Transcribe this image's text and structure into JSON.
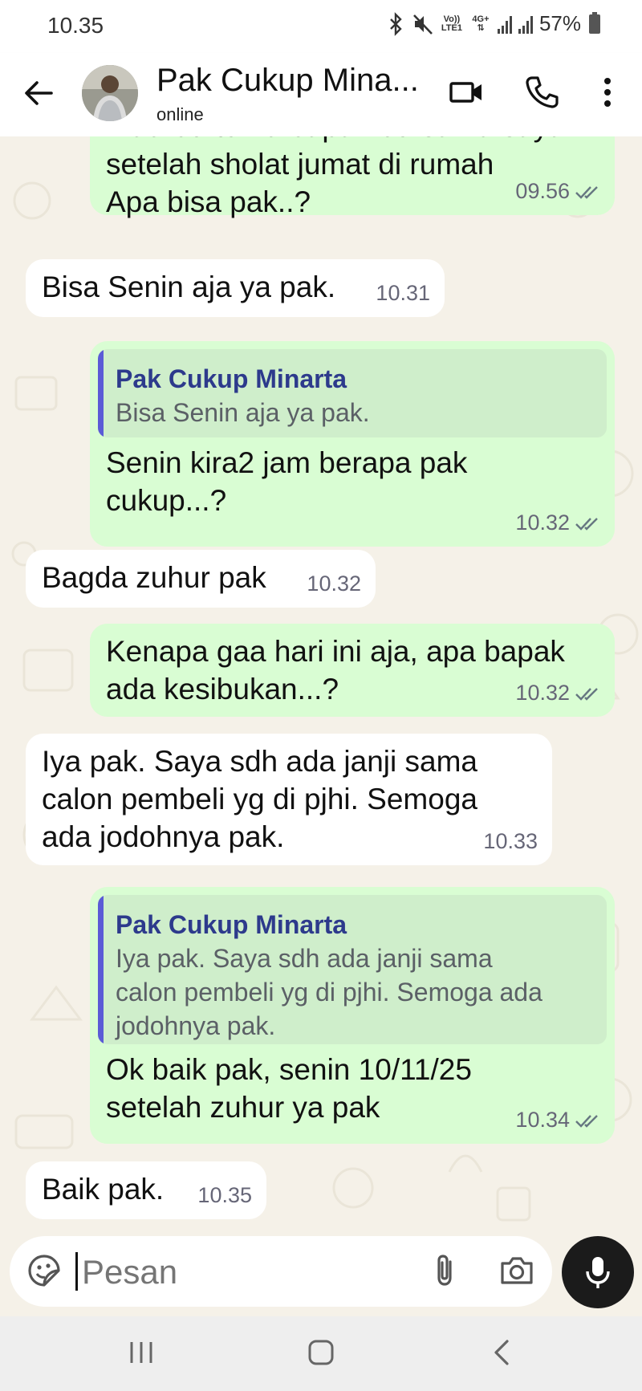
{
  "status_bar": {
    "time": "10.35",
    "network_label": "Vo)) LTE1",
    "network_type": "4G+",
    "battery": "57%"
  },
  "header": {
    "contact_name": "Pak Cukup Mina...",
    "status": "online"
  },
  "messages": [
    {
      "dir": "out",
      "text": [
        "Mau bertemu bapak bersama saya",
        "setelah sholat jumat di rumah",
        "Apa bisa pak..?"
      ],
      "time": "09.56"
    },
    {
      "dir": "in",
      "text": [
        "Bisa Senin aja ya pak."
      ],
      "time": "10.31"
    },
    {
      "dir": "out",
      "quote": {
        "name": "Pak Cukup Minarta",
        "text": [
          "Bisa Senin aja ya pak."
        ]
      },
      "text": [
        "Senin kira2 jam berapa pak",
        "cukup...?"
      ],
      "time": "10.32"
    },
    {
      "dir": "in",
      "text": [
        "Bagda zuhur pak"
      ],
      "time": "10.32"
    },
    {
      "dir": "out",
      "text": [
        "Kenapa gaa hari ini aja, apa bapak",
        "ada kesibukan...?"
      ],
      "time": "10.32"
    },
    {
      "dir": "in",
      "text": [
        "Iya pak. Saya sdh ada janji sama",
        "calon pembeli yg di pjhi. Semoga",
        "ada jodohnya pak."
      ],
      "time": "10.33"
    },
    {
      "dir": "out",
      "quote": {
        "name": "Pak Cukup Minarta",
        "text": [
          "Iya pak. Saya sdh ada janji sama",
          "calon pembeli yg di pjhi. Semoga ada",
          "jodohnya pak."
        ]
      },
      "text": [
        "Ok baik pak, senin 10/11/25",
        "setelah zuhur ya pak"
      ],
      "time": "10.34"
    },
    {
      "dir": "in",
      "text": [
        "Baik pak."
      ],
      "time": "10.35"
    }
  ],
  "composer": {
    "placeholder": "Pesan"
  },
  "colors": {
    "incoming_bubble": "#ffffff",
    "outgoing_bubble": "#d9fdd3",
    "quote_bar": "#5b5bd6",
    "quote_name": "#2d3a8c",
    "chat_background": "#f5f1e8",
    "read_ticks": "#667781"
  },
  "icons": [
    "back-arrow-icon",
    "video-call-icon",
    "voice-call-icon",
    "more-options-icon",
    "sticker-icon",
    "attachment-icon",
    "camera-icon",
    "mic-icon",
    "nav-recents-icon",
    "nav-home-icon",
    "nav-back-icon"
  ]
}
